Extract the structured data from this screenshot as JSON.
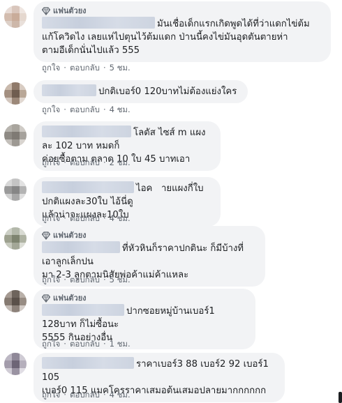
{
  "colors": {
    "bubble": "#f2f3f5",
    "meta": "#606770",
    "text": "#1c1e21"
  },
  "comments": [
    {
      "badge": "แฟนตัวยง",
      "text_line1": "มันเชื่อเด็กแรกเกิดพูดได้ที่ว่าแดกไข่ต้ม",
      "text_rest": "แก้โควิดไง เลยแห่ไปตุนไว้ต้มแดก ป่านนี้คงไข่มันอุดตันตายห่า\nตามอีเด็กนั่นไปแล้ว 555",
      "like": "ถูกใจ",
      "reply": "ตอบกลับ",
      "time": "5 ชม."
    },
    {
      "badge": "",
      "text_line1": "ปกติเบอร์0 120บาทไม่ต้องแย่งใคร",
      "text_rest": "",
      "like": "ถูกใจ",
      "reply": "ตอบกลับ",
      "time": "4 ชม."
    },
    {
      "badge": "",
      "text_line1": "โลตัส ไซส์ m แผงละ 102 บาท หมดก็",
      "text_rest": "ค่อยซื้อตาม ตลาด 10 ใบ 45 บาทเอา",
      "like": "ถูกใจ",
      "reply": "ตอบกลับ",
      "time": "2 ชม."
    },
    {
      "badge": "",
      "text_line1": "ไอค   ายแผงกี่ใบ ปกติแผงละ30ใบ ไอ้นี่ดู",
      "text_rest": "แล้วน่าจะแผงละ10ใบ",
      "like": "ถูกใจ",
      "reply": "ตอบกลับ",
      "time": "4 ชม."
    },
    {
      "badge": "แฟนตัวยง",
      "text_line1": "ที่หัวหินก็ราคาปกตินะ ก็มีบ้างที่เอาลูกเล็กปน",
      "text_rest": "มา 2-3 ลูกตามนิสัยพ่อค้าแม่ค้าแหละ",
      "like": "ถูกใจ",
      "reply": "ตอบกลับ",
      "time": "5 ชม."
    },
    {
      "badge": "แฟนตัวยง",
      "text_line1": "ปากซอยหมู่บ้านเบอร์1 128บาท ก็ไม่ซื้อนะ",
      "text_rest": "5555 กินอย่างอื่น",
      "like": "ถูกใจ",
      "reply": "ตอบกลับ",
      "time": "1 ชม."
    },
    {
      "badge": "",
      "text_line1": "ราคาเบอร์3 88 เบอร์2 92 เบอร์1 105",
      "text_rest": "เบอร์0 115 แมคโครราคาเสมอต้นเสมอปลายมากกกกกก",
      "like": "ถูกใจ",
      "reply": "ตอบกลับ",
      "time": "4 ชม."
    }
  ]
}
